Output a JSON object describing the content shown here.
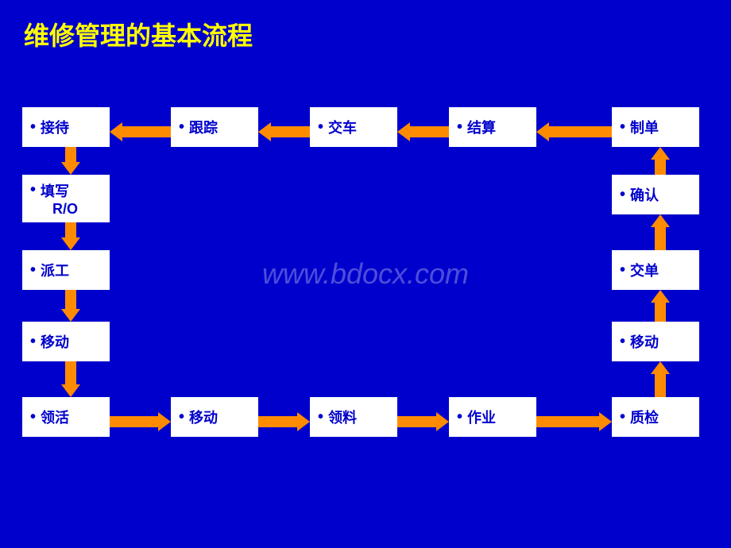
{
  "title": "维修管理的基本流程",
  "watermark": "www.bdocx.com",
  "boxes": {
    "jiedai": {
      "label": "接待",
      "bullet": "•"
    },
    "tiexie": {
      "label": "填写\nR/O",
      "bullet": "•"
    },
    "paigong": {
      "label": "派工",
      "bullet": "•"
    },
    "yidong1": {
      "label": "移动",
      "bullet": "•"
    },
    "linghuo": {
      "label": "领活",
      "bullet": "•"
    },
    "genzong": {
      "label": "跟踪",
      "bullet": "•"
    },
    "jiaoche": {
      "label": "交车",
      "bullet": "•"
    },
    "jiesuan": {
      "label": "结算",
      "bullet": "•"
    },
    "zhidan": {
      "label": "制单",
      "bullet": "•"
    },
    "queren": {
      "label": "确认",
      "bullet": "•"
    },
    "jiaodan": {
      "label": "交单",
      "bullet": "•"
    },
    "yidong2": {
      "label": "移动",
      "bullet": "•"
    },
    "zhijian": {
      "label": "质检",
      "bullet": "•"
    },
    "zuoye": {
      "label": "作业",
      "bullet": "•"
    },
    "lingliao": {
      "label": "领料",
      "bullet": "•"
    },
    "yidong3": {
      "label": "移动",
      "bullet": "•"
    }
  }
}
